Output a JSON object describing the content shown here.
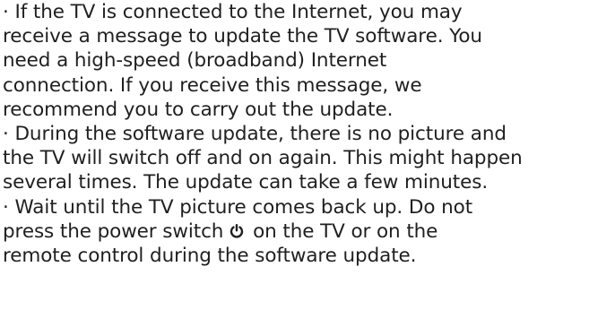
{
  "document": {
    "bullets": [
      {
        "lines": [
          "· If the TV is connected to the Internet, you may",
          "receive a message to update the TV software. You",
          "need a high-speed (broadband) Internet",
          "connection. If you receive this message, we",
          "recommend you to carry out the update."
        ]
      },
      {
        "lines": [
          "· During the software update, there is no picture and",
          "the TV will switch off and on again. This might happen",
          "several times. The update can take a few minutes."
        ]
      },
      {
        "lines": [
          "· Wait until the TV picture comes back up. Do not"
        ],
        "power_line_before": "press the power switch",
        "power_line_after": "on the TV or on the",
        "last_line": "remote control during the software update."
      }
    ],
    "power_icon": "power-icon"
  }
}
